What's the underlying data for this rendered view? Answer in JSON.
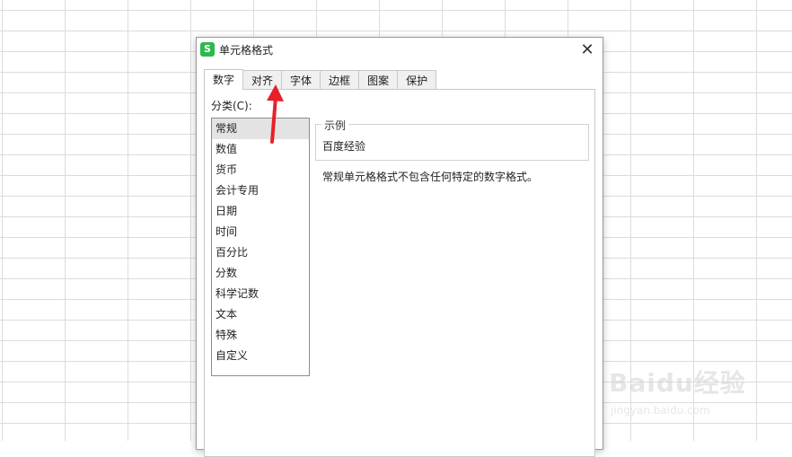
{
  "dialog": {
    "title": "单元格格式",
    "app_icon_letter": "S",
    "close_glyph": "✕"
  },
  "tabs": [
    {
      "label": "数字",
      "active": true
    },
    {
      "label": "对齐"
    },
    {
      "label": "字体"
    },
    {
      "label": "边框"
    },
    {
      "label": "图案"
    },
    {
      "label": "保护"
    }
  ],
  "category": {
    "label": "分类(C):",
    "items": [
      "常规",
      "数值",
      "货币",
      "会计专用",
      "日期",
      "时间",
      "百分比",
      "分数",
      "科学记数",
      "文本",
      "特殊",
      "自定义"
    ],
    "selected": "常规"
  },
  "sample": {
    "legend": "示例",
    "value": "百度经验"
  },
  "description": "常规单元格格式不包含任何特定的数字格式。",
  "watermark": {
    "logo": "Baidu经验",
    "url": "jingyan.baidu.com"
  },
  "colors": {
    "app_icon": "#2db84d",
    "arrow": "#e8202a",
    "selected_item": "#e3e3e3"
  }
}
